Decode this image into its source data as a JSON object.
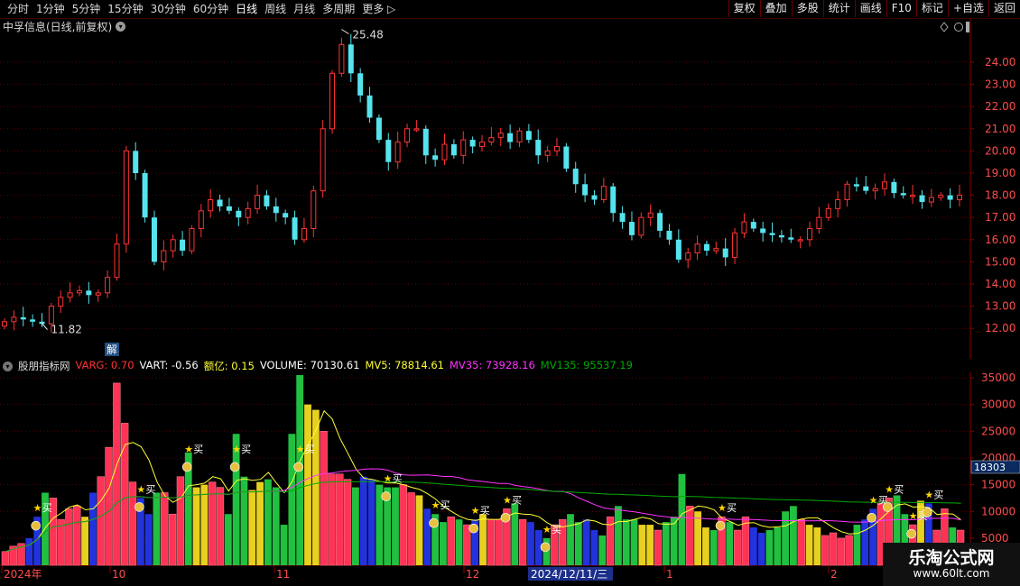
{
  "toolbar": {
    "periods": [
      "分时",
      "1分钟",
      "5分钟",
      "15分钟",
      "30分钟",
      "60分钟",
      "日线",
      "周线",
      "月线",
      "多周期",
      "更多"
    ],
    "active_period": "日线",
    "right_buttons": [
      "复权",
      "叠加",
      "多股",
      "统计",
      "画线",
      "F10",
      "标记",
      "+自选",
      "返回"
    ]
  },
  "price_panel": {
    "title": "中孚信息(日线,前复权)",
    "high_label": "25.48",
    "low_label": "11.82",
    "jie_mark": "解",
    "y_axis": [
      "24.00",
      "23.00",
      "22.00",
      "21.00",
      "20.00",
      "19.00",
      "18.00",
      "17.00",
      "16.00",
      "15.00",
      "14.00",
      "13.00",
      "12.00"
    ]
  },
  "indicator_panel": {
    "name": "股朋指标网",
    "values": [
      {
        "label": "VARG: 0.70",
        "color": "#ff3333"
      },
      {
        "label": "VART: -0.56",
        "color": "#ffffff"
      },
      {
        "label": "额亿: 0.15",
        "color": "#ffff33"
      },
      {
        "label": "VOLUME: 70130.61",
        "color": "#ffffff"
      },
      {
        "label": "MV5: 78814.61",
        "color": "#ffff33"
      },
      {
        "label": "MV35: 73928.16",
        "color": "#ff33ff"
      },
      {
        "label": "MV135: 95537.19",
        "color": "#00aa00"
      }
    ],
    "y_axis": [
      "35000",
      "30000",
      "25000",
      "20000",
      "15000",
      "10000",
      "5000"
    ],
    "current_marker": "18303",
    "buy_label": "买"
  },
  "x_axis": {
    "labels": [
      "2024年",
      "10",
      "11",
      "12",
      "1",
      "2"
    ],
    "cursor_date": "2024/12/11/三"
  },
  "watermark": {
    "title": "乐淘公式网",
    "url": "www.60lt.com"
  },
  "colors": {
    "up": "#ff3333",
    "down": "#55e4ee",
    "grid": "#5a0000"
  }
}
